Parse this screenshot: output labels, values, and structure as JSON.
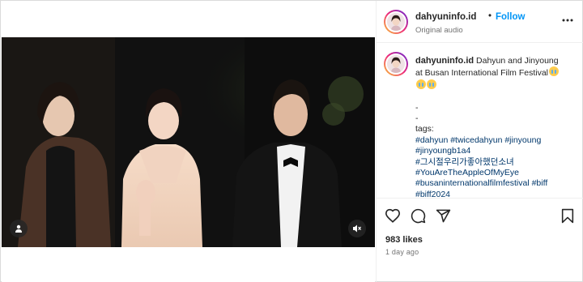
{
  "header": {
    "username": "dahyuninfo.id",
    "separator": "•",
    "follow_label": "Follow",
    "audio_label": "Original audio"
  },
  "caption": {
    "username": "dahyuninfo.id",
    "lines": [
      "Dahyun and Jinyoung",
      "at Busan International Film Festival"
    ],
    "spacer_lines": [
      "-",
      "-"
    ],
    "tags_label": "tags:",
    "hashtags": [
      "#dahyun #twicedahyun #jinyoung",
      "#jinyoungb1a4",
      "#그시절우리가좋아했던소녀",
      "#YouAreTheAppleOfMyEye",
      "#busaninternationalfilmfestival #biff",
      "#biff2024"
    ]
  },
  "icons": {
    "more": "more-horizontal-icon",
    "like": "heart-icon",
    "comment": "comment-icon",
    "share": "share-icon",
    "save": "bookmark-icon",
    "user_tag": "user-icon",
    "mute": "speaker-muted-icon",
    "emoji": "loudly-crying-face-emoji"
  },
  "stats": {
    "likes": "983 likes",
    "time_ago": "1 day ago"
  },
  "colors": {
    "follow": "#0095f6",
    "hashtag": "#00376b",
    "muted_text": "#737373"
  }
}
